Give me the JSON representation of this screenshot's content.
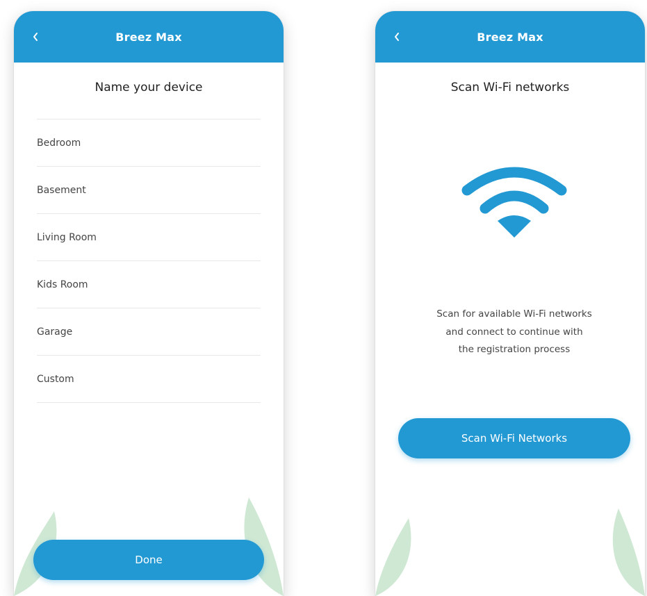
{
  "colors": {
    "primary": "#2399d4",
    "leaf": "#cfe8d4"
  },
  "left_screen": {
    "header": {
      "title": "Breez Max",
      "back_icon": "chevron-left-icon"
    },
    "title": "Name your device",
    "device_names": [
      "Bedroom",
      "Basement",
      "Living Room",
      "Kids Room",
      "Garage",
      "Custom"
    ],
    "done_label": "Done"
  },
  "right_screen": {
    "header": {
      "title": "Breez Max",
      "back_icon": "chevron-left-icon"
    },
    "title": "Scan Wi-Fi networks",
    "wifi_icon": "wifi-icon",
    "description_lines": [
      "Scan for available Wi-Fi networks",
      "and connect to continue with",
      "the registration process"
    ],
    "scan_label": "Scan Wi-Fi Networks"
  }
}
